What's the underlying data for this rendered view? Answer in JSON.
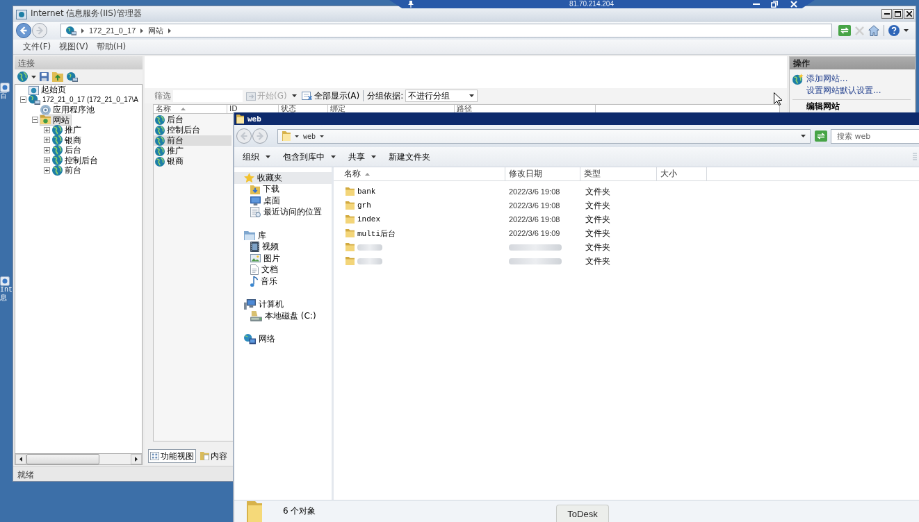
{
  "remote_toolbar": {
    "address": "81.70.214.204"
  },
  "desktop_icons": [
    {
      "lines": [
        "百"
      ]
    },
    {
      "lines": [
        "Int",
        "息"
      ]
    }
  ],
  "iis_manager": {
    "title": "Internet 信息服务(IIS)管理器",
    "breadcrumb": [
      "172_21_0_17",
      "网站"
    ],
    "menu": [
      "文件(F)",
      "视图(V)",
      "帮助(H)"
    ],
    "connections": {
      "title": "连接",
      "tree": [
        {
          "kind": "start",
          "label": "起始页",
          "selected": false
        },
        {
          "kind": "server",
          "label": "172_21_0_17 (172_21_0_17\\A",
          "selected": false,
          "expanded": true,
          "children": [
            {
              "kind": "pool",
              "label": "应用程序池",
              "selected": false
            },
            {
              "kind": "sites",
              "label": "网站",
              "selected": true,
              "expanded": true,
              "children": [
                {
                  "kind": "site",
                  "label": "推广",
                  "selected": false,
                  "expanded": false
                },
                {
                  "kind": "site",
                  "label": "银商",
                  "selected": false,
                  "expanded": false
                },
                {
                  "kind": "site",
                  "label": "后台",
                  "selected": false,
                  "expanded": false
                },
                {
                  "kind": "site",
                  "label": "控制后台",
                  "selected": false,
                  "expanded": false
                },
                {
                  "kind": "site",
                  "label": "前台",
                  "selected": false,
                  "expanded": false
                }
              ]
            }
          ]
        }
      ]
    },
    "filter": {
      "label": "筛选",
      "start": {
        "label": "开始(G)",
        "disabled": true
      },
      "show_all": {
        "label": "全部显示(A)",
        "disabled": false
      },
      "group_label": "分组依据:",
      "group_value": "不进行分组"
    },
    "columns": [
      {
        "label": "名称",
        "sorted": true
      },
      {
        "label": "ID",
        "sorted": false
      },
      {
        "label": "状态",
        "sorted": false
      },
      {
        "label": "绑定",
        "sorted": false
      },
      {
        "label": "路径",
        "sorted": false
      }
    ],
    "sites": [
      {
        "name": "后台",
        "selected": false
      },
      {
        "name": "控制后台",
        "selected": false
      },
      {
        "name": "前台",
        "selected": true
      },
      {
        "name": "推广",
        "selected": false
      },
      {
        "name": "银商",
        "selected": false
      }
    ],
    "view_tabs": [
      {
        "label": "功能视图",
        "selected": true
      },
      {
        "label": "内容",
        "selected": false
      }
    ],
    "status": "就绪",
    "actions": {
      "title": "操作",
      "items": [
        {
          "kind": "add",
          "label": "添加网站..."
        },
        {
          "kind": "link",
          "label": "设置网站默认设置..."
        },
        {
          "kind": "heading",
          "label": "编辑网站"
        }
      ]
    }
  },
  "explorer": {
    "title": "web",
    "path": [
      "web"
    ],
    "search": {
      "placeholder": "搜索 web"
    },
    "toolbar": [
      {
        "label": "组织",
        "menu": true
      },
      {
        "label": "包含到库中",
        "menu": true
      },
      {
        "label": "共享",
        "menu": true
      },
      {
        "label": "新建文件夹",
        "menu": false
      }
    ],
    "nav": [
      {
        "kind": "favorites",
        "label": "收藏夹",
        "selected": true,
        "children": [
          {
            "kind": "downloads",
            "label": "下载",
            "selected": false
          },
          {
            "kind": "desktop",
            "label": "桌面",
            "selected": false
          },
          {
            "kind": "recent",
            "label": "最近访问的位置",
            "selected": false
          }
        ]
      },
      {
        "kind": "libraries",
        "label": "库",
        "selected": false,
        "children": [
          {
            "kind": "videos",
            "label": "视频",
            "selected": false
          },
          {
            "kind": "pictures",
            "label": "图片",
            "selected": false
          },
          {
            "kind": "documents",
            "label": "文档",
            "selected": false
          },
          {
            "kind": "music",
            "label": "音乐",
            "selected": false
          }
        ]
      },
      {
        "kind": "computer",
        "label": "计算机",
        "selected": false,
        "children": [
          {
            "kind": "disk",
            "label": "本地磁盘 (C:)",
            "selected": false
          }
        ]
      },
      {
        "kind": "network",
        "label": "网络",
        "selected": false
      }
    ],
    "columns": [
      {
        "label": "名称",
        "sorted": true
      },
      {
        "label": "修改日期",
        "sorted": false
      },
      {
        "label": "类型",
        "sorted": false
      },
      {
        "label": "大小",
        "sorted": false
      }
    ],
    "files": [
      {
        "name": "bank",
        "modified": "2022/3/6 19:08",
        "type": "文件夹",
        "selected": false,
        "redacted": false
      },
      {
        "name": "grh",
        "modified": "2022/3/6 19:08",
        "type": "文件夹",
        "selected": false,
        "redacted": false
      },
      {
        "name": "index",
        "modified": "2022/3/6 19:08",
        "type": "文件夹",
        "selected": false,
        "redacted": false
      },
      {
        "name": "multi后台",
        "modified": "2022/3/6 19:09",
        "type": "文件夹",
        "selected": false,
        "redacted": false
      },
      {
        "type": "文件夹",
        "selected": false,
        "redacted": true
      },
      {
        "type": "文件夹",
        "selected": false,
        "redacted": true
      }
    ],
    "status": "6 个对象"
  },
  "taskbar_button": "ToDesk"
}
